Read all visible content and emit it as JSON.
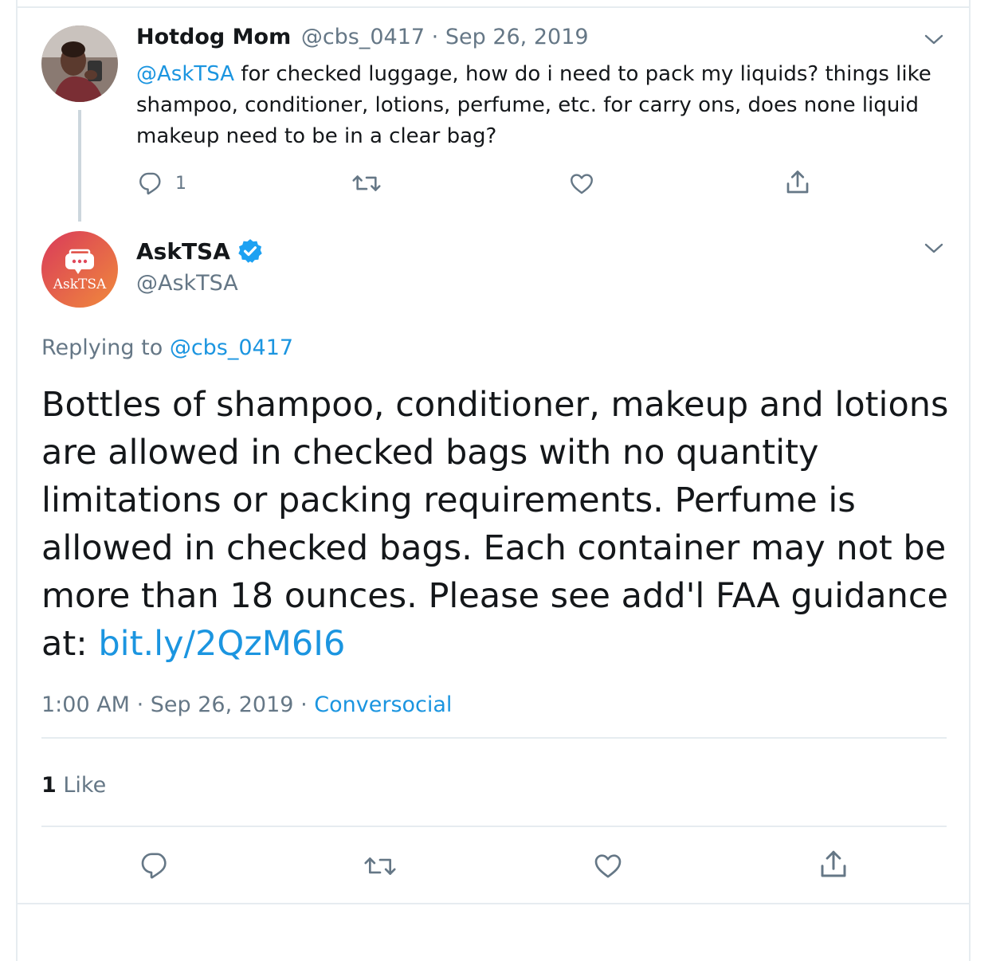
{
  "original_tweet": {
    "display_name": "Hotdog Mom",
    "handle": "@cbs_0417",
    "separator": "·",
    "date": "Sep 26, 2019",
    "mention": "@AskTSA",
    "text": " for checked luggage, how do i need to pack my liquids? things like shampoo, conditioner, lotions, perfume, etc. for carry ons, does none liquid makeup need to be in a clear bag?",
    "reply_count": "1",
    "icons": [
      "reply-icon",
      "retweet-icon",
      "like-icon",
      "share-icon",
      "chevron-down-icon"
    ]
  },
  "reply_tweet": {
    "display_name": "AskTSA",
    "handle": "@AskTSA",
    "avatar_text": "AskTSA",
    "replying_to_label": "Replying to",
    "replying_to_handle": "@cbs_0417",
    "text": "Bottles of shampoo, conditioner, makeup and lotions are allowed in checked bags with no quantity limitations or packing requirements. Perfume is allowed in checked bags. Each container may not be more than 18 ounces. Please see add'l FAA guidance at: ",
    "link": "bit.ly/2QzM6I6",
    "time": "1:00 AM",
    "separator": "·",
    "date": "Sep 26, 2019",
    "source": "Conversocial",
    "like_count": "1",
    "like_label": "Like",
    "icons": [
      "verified-badge-icon",
      "reply-icon",
      "retweet-icon",
      "like-icon",
      "share-icon",
      "chevron-down-icon"
    ]
  },
  "colors": {
    "link": "#1b95e0",
    "muted": "#657786",
    "text": "#14171a",
    "divider": "#e6ecf0",
    "asktsa_avatar_start": "#e8404f",
    "asktsa_avatar_end": "#f08a3c"
  }
}
